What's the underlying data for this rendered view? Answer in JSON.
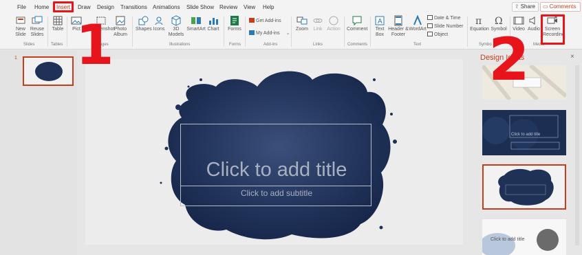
{
  "menu": {
    "tabs": [
      "File",
      "Home",
      "Insert",
      "Draw",
      "Design",
      "Transitions",
      "Animations",
      "Slide Show",
      "Review",
      "View",
      "Help"
    ],
    "active_tab": "Insert",
    "share_label": "Share",
    "comments_label": "Comments"
  },
  "ribbon": {
    "buttons": {
      "new_slide": "New Slide",
      "reuse_slides": "Reuse Slides",
      "table": "Table",
      "pictures": "Pict",
      "screenshot": "Screenshot",
      "photo_album": "Photo Album",
      "shapes": "Shapes",
      "icons": "Icons",
      "models_3d": "3D Models",
      "smartart": "SmartArt",
      "chart": "Chart",
      "forms": "Forms",
      "get_addins": "Get Add-ins",
      "my_addins": "My Add-ins",
      "zoom": "Zoom",
      "link": "Link",
      "action": "Action",
      "comment": "Comment",
      "text_box": "Text Box",
      "header_footer": "Header & Footer",
      "wordart": "WordArt",
      "date_time": "Date & Time",
      "slide_number": "Slide Number",
      "object": "Object",
      "equation": "Equation",
      "symbol": "Symbol",
      "video": "Video",
      "audio": "Audio",
      "screen_recording": "Screen Recording"
    },
    "groups": {
      "slides": "Slides",
      "tables": "Tables",
      "images": "Images",
      "illustrations": "Illustrations",
      "forms": "Forms",
      "addins": "Add-ins",
      "links": "Links",
      "comments": "Comments",
      "text": "Text",
      "symbols": "Symbo",
      "media": "Media"
    }
  },
  "slides_pane": {
    "slide_number": "1"
  },
  "slide": {
    "title_placeholder": "Click to add title",
    "subtitle_placeholder": "Click to add subtitle"
  },
  "design_ideas": {
    "title": "Design Ideas",
    "close": "×",
    "idea_labels": [
      "Click to add title",
      "Click to add title"
    ]
  },
  "annotations": {
    "step1": "1",
    "step2": "2"
  },
  "colors": {
    "accent": "#c43e1c",
    "highlight": "#e8141c",
    "splash": "#1f3157"
  }
}
